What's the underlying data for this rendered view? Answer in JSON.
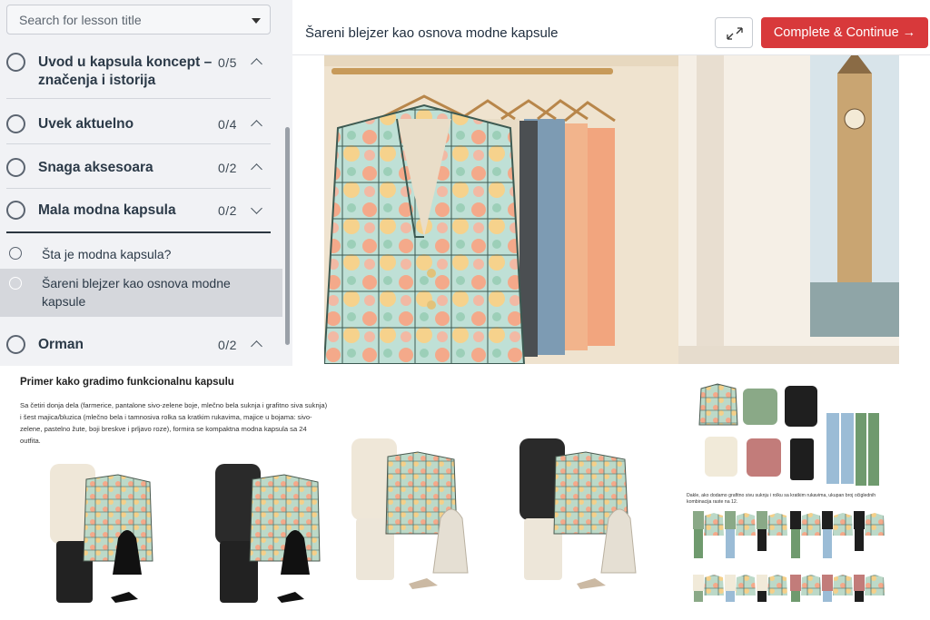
{
  "sidebar": {
    "search": {
      "placeholder": "Search for lesson title"
    },
    "sections": [
      {
        "title_line1": "Uvod u kapsula koncept –",
        "title_line2": "značenja i istorija",
        "count": "0/5",
        "expanded": false
      },
      {
        "title": "Uvek aktuelno",
        "count": "0/4",
        "expanded": false
      },
      {
        "title": "Snaga aksesoara",
        "count": "0/2",
        "expanded": false
      },
      {
        "title": "Mala modna kapsula",
        "count": "0/2",
        "expanded": true
      },
      {
        "title": "Orman",
        "count": "0/2",
        "expanded": false
      }
    ],
    "lessons": [
      {
        "title": "Šta je modna kapsula?",
        "active": false
      },
      {
        "title_line1": "Šareni blejzer kao osnova modne",
        "title_line2": "kapsule",
        "active": true
      }
    ]
  },
  "header": {
    "title": "Šareni blejzer kao osnova modne kapsule",
    "expand_icon": "expand-icon",
    "complete_label": "Complete & Continue →",
    "accent": "#d8393b"
  },
  "infographic": {
    "title": "Primer kako gradimo funkcionalnu kapsulu",
    "description": "Sa četiri donja dela (farmerice, pantalone sivo-zelene boje, mlečno bela suknja i grafitno siva suknja) i šest majica/bluzica (mlečno bela i tamnosiva rolka sa kratkim rukavima, majice u bojama: sivo-zelene, pastelno žute, boji breskve i prljavo roze), formira se kompaktna modna kapsula sa 24 outfita.",
    "note": "Dakle, ako dodamo grafitno sivu suknju i rolku sa kratkim rukavima, ukupan broj očiglednih kombinacija raste na 12."
  }
}
